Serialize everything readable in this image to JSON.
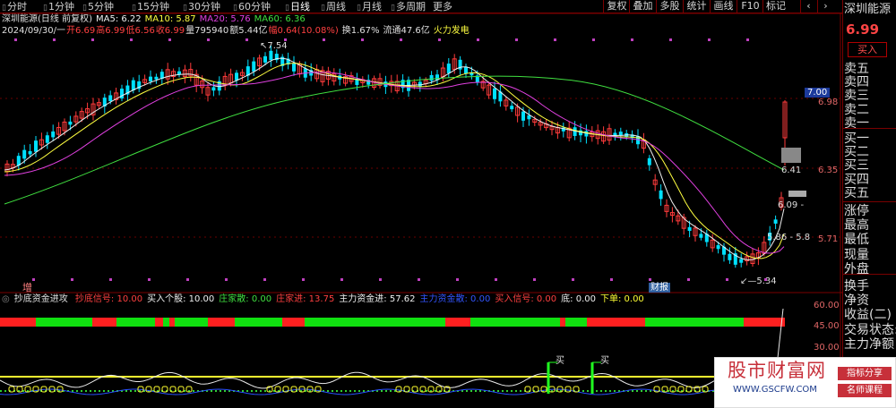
{
  "periods": [
    "分时",
    "1分钟",
    "5分钟",
    "15分钟",
    "30分钟",
    "60分钟",
    "日线",
    "周线",
    "月线",
    "多周期",
    "更多"
  ],
  "active_period": "日线",
  "right_buttons": [
    "复权",
    "叠加",
    "多股",
    "统计",
    "画线",
    "F10",
    "标记"
  ],
  "nav_icons": [
    "back-icon",
    "forward-icon"
  ],
  "info_line1": {
    "name": "深圳能源(日线 前复权)",
    "ma5": "MA5: 6.22",
    "ma10": "MA10: 5.87",
    "ma20": "MA20: 5.76",
    "ma60": "MA60: 6.36"
  },
  "info_line2": {
    "date": "2024/09/30/一",
    "open": "开6.69",
    "high": "高6.99",
    "low": "低6.56",
    "close": "收6.99",
    "volume": "量795940",
    "amount": "额5.44亿",
    "range": "幅0.64(10.08%)",
    "turnover": "换1.67%",
    "float": "流通47.6亿",
    "concept": "火力发电"
  },
  "price_axis": [
    "7.00",
    "6.98",
    "6.35",
    "5.71"
  ],
  "annotations": {
    "high_mark": "7.54",
    "low_mark": "5.34",
    "p641": "6.41",
    "p609": "6.09 -",
    "p586": "5.86 - 5.8",
    "zeng": "增",
    "caibao": "财报"
  },
  "indicator": {
    "name": "抄底资金进攻",
    "items": [
      {
        "label": "抄底信号: 10.00",
        "color": "#ff4040"
      },
      {
        "label": "买入个股: 10.00",
        "color": "#f0f0f0"
      },
      {
        "label": "庄家散: 0.00",
        "color": "#40e040"
      },
      {
        "label": "庄家进: 13.75",
        "color": "#ff4040"
      },
      {
        "label": "主力资金进: 57.62",
        "color": "#f0f0f0"
      },
      {
        "label": "主力资金散: 0.00",
        "color": "#3355ff"
      },
      {
        "label": "买入信号: 0.00",
        "color": "#ff4040"
      },
      {
        "label": "底: 0.00",
        "color": "#f0f0f0"
      },
      {
        "label": "下单: 0.00",
        "color": "#ffff33"
      }
    ],
    "axis": [
      "60.00",
      "45.00",
      "30.00"
    ],
    "buy_label": "买"
  },
  "side": {
    "title": "深圳能源",
    "price": "6.99",
    "buy_button": "买入",
    "order_rows": [
      "卖五",
      "卖四",
      "卖三",
      "卖二",
      "卖一",
      "买一",
      "买二",
      "买三",
      "买四",
      "买五"
    ],
    "stat_rows": [
      "涨停",
      "最高",
      "最低",
      "现量",
      "外盘",
      "换手",
      "净资",
      "收益(二)",
      "交易状态:",
      "主力净额"
    ]
  },
  "watermark": {
    "big": "股市财富网",
    "url": "WWW.GSCFW.COM",
    "badge1": "指标分享",
    "badge2": "名师课程"
  },
  "colors": {
    "up": "#ff3b3b",
    "down": "#00e0ff",
    "ma5": "#f0f0f0",
    "ma10": "#ffff40",
    "ma20": "#e040e0",
    "ma60": "#40e040",
    "border": "#7a0000"
  }
}
